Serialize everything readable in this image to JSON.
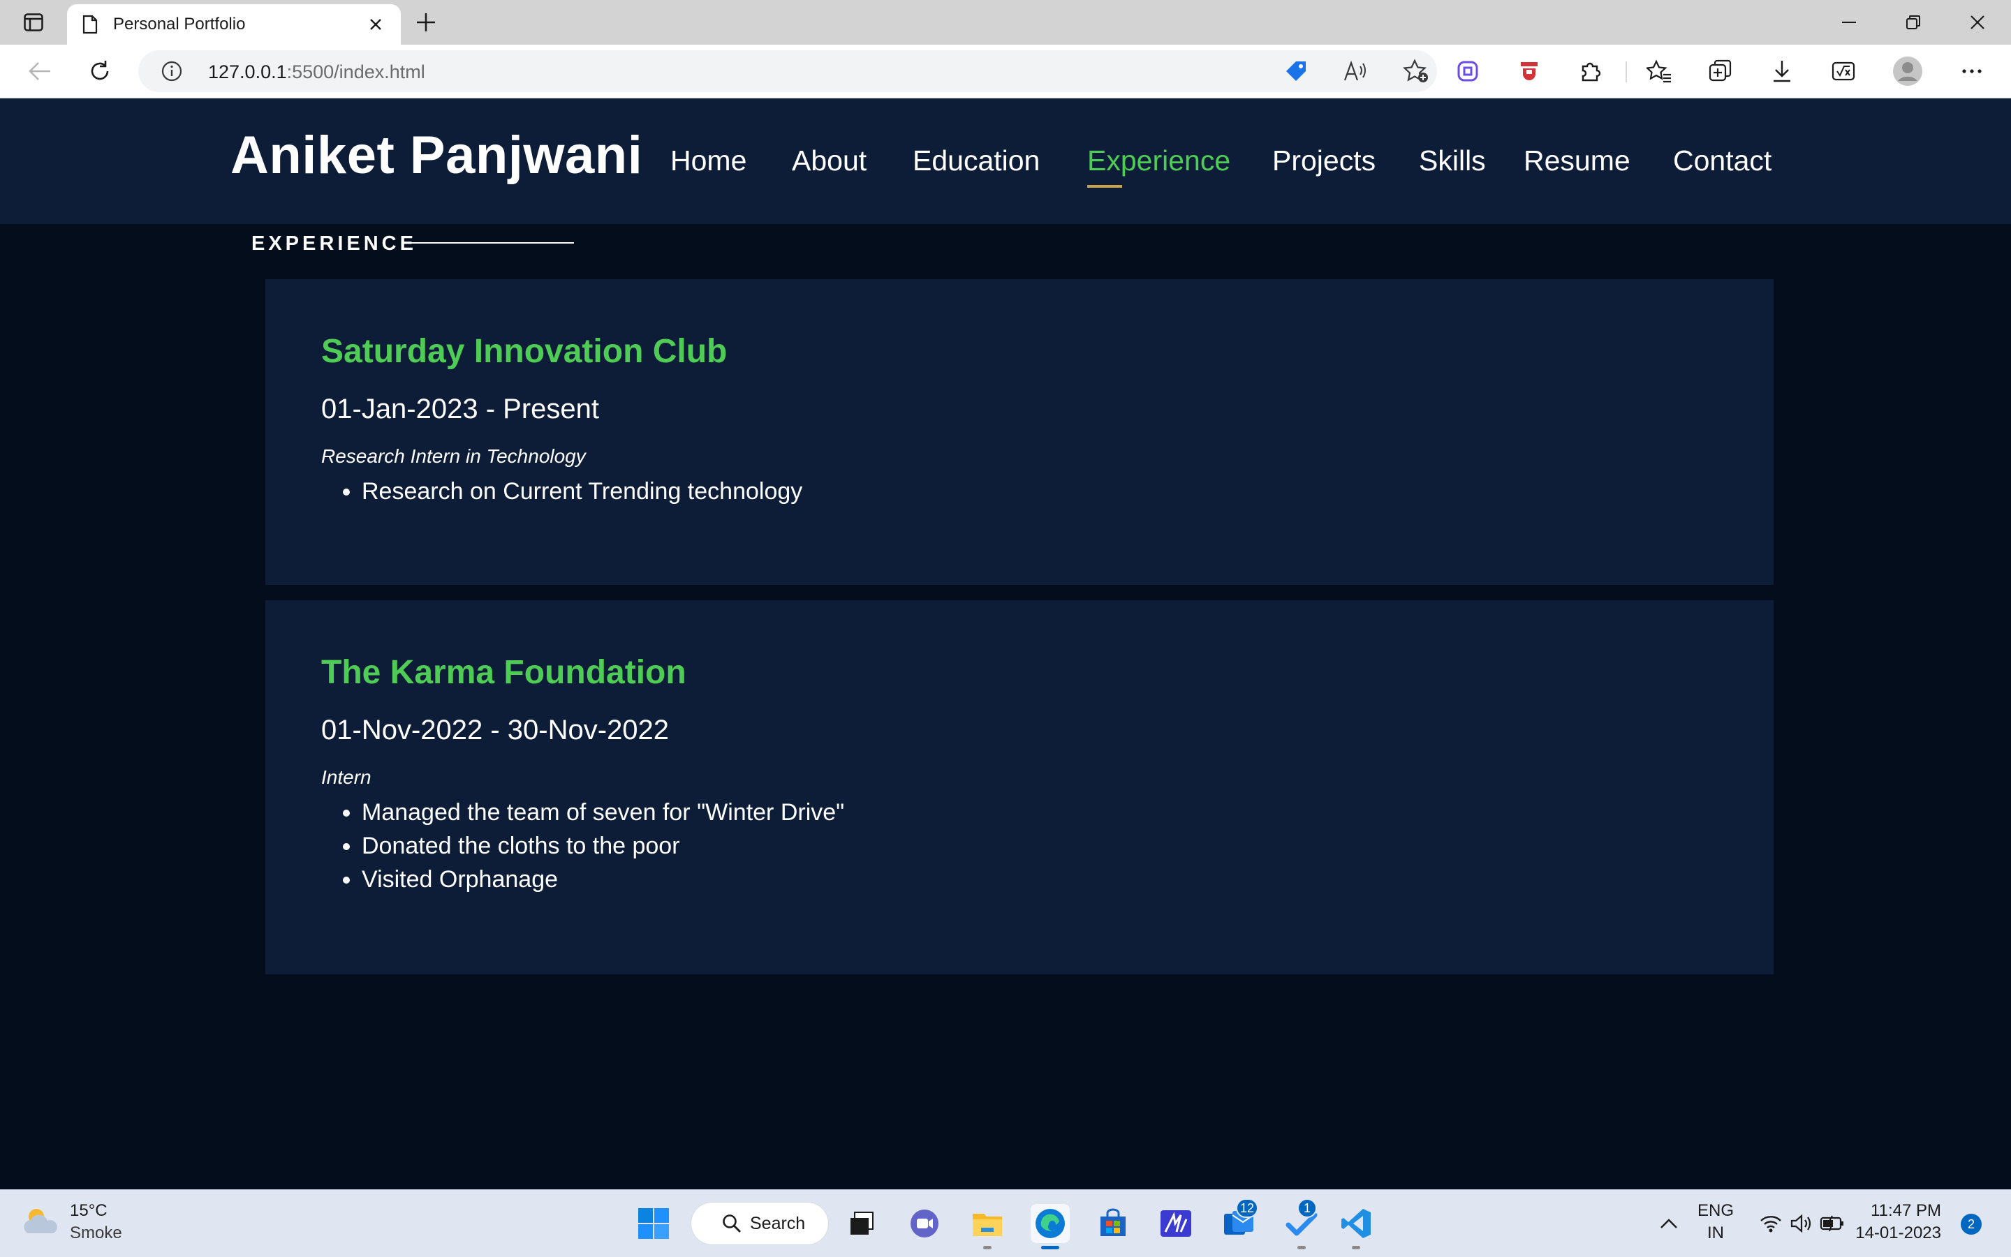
{
  "browser": {
    "tab_title": "Personal Portfolio",
    "url_host": "127.0.0.1",
    "url_rest": ":5500/index.html"
  },
  "site": {
    "brand": "Aniket Panjwani",
    "menu": [
      "Home",
      "About",
      "Education",
      "Experience",
      "Projects",
      "Skills",
      "Resume",
      "Contact"
    ],
    "active_menu": "Experience"
  },
  "experience": {
    "section_title": "EXPERIENCE",
    "items": [
      {
        "org": "Saturday Innovation Club",
        "dates": "01-Jan-2023 - Present",
        "role": "Research Intern in Technology",
        "points": [
          "Research on Current Trending technology"
        ]
      },
      {
        "org": "The Karma Foundation",
        "dates": "01-Nov-2022 - 30-Nov-2022",
        "role": "Intern",
        "points": [
          "Managed the team of seven for \"Winter Drive\"",
          "Donated the cloths to the poor",
          "Visited Orphanage"
        ]
      }
    ]
  },
  "taskbar": {
    "weather_temp": "15°C",
    "weather_cond": "Smoke",
    "search_label": "Search",
    "mail_badge": "12",
    "todo_badge": "1",
    "lang_1": "ENG",
    "lang_2": "IN",
    "time": "11:47 PM",
    "date": "14-01-2023",
    "notifications": "2"
  },
  "colors": {
    "accent_green": "#4ecc55",
    "navbar_bg": "#0e1d37",
    "page_bg": "#040d1b",
    "underline_gold": "#c9a24c"
  }
}
